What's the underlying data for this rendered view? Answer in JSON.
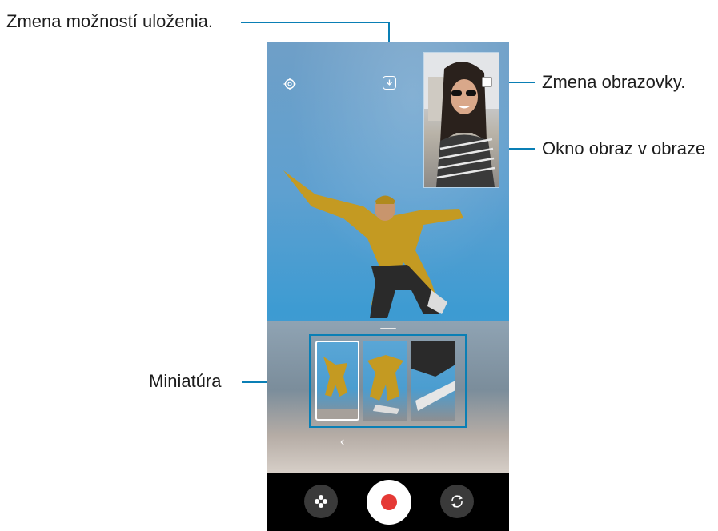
{
  "callouts": {
    "save_options": "Zmena možností uloženia.",
    "switch_screen": "Zmena obrazovky.",
    "pip_window": "Okno obraz v obraze",
    "thumbnail": "Miniatúra"
  },
  "icons": {
    "settings": "gear-icon",
    "save": "download-icon",
    "switch": "switch-screens-icon",
    "effects": "filter-flower-icon",
    "record": "record-icon",
    "flip": "flip-camera-icon",
    "chevron": "chevron-left-icon"
  },
  "colors": {
    "callout_line": "#0a7fb5",
    "record": "#e53935"
  }
}
